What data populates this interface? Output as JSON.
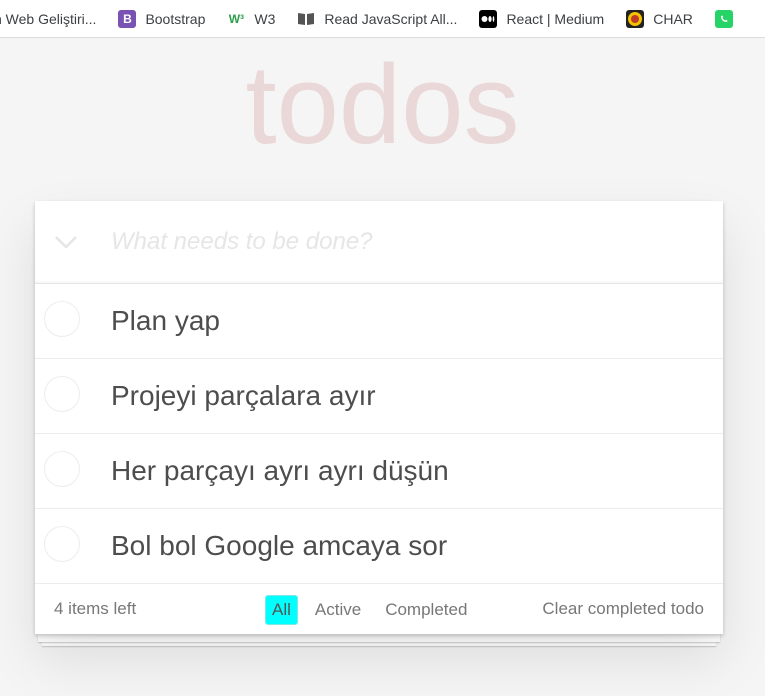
{
  "bookmarks": [
    {
      "label": "n Web Geliştiri...",
      "icon": "none"
    },
    {
      "label": "Bootstrap",
      "icon": "bootstrap-icon",
      "glyph": "B"
    },
    {
      "label": "W3",
      "icon": "w3-icon",
      "glyph": "W³"
    },
    {
      "label": "Read JavaScript All...",
      "icon": "book-icon",
      "glyph": "📖"
    },
    {
      "label": "React | Medium",
      "icon": "medium-icon",
      "glyph": "●●"
    },
    {
      "label": "CHAR",
      "icon": "char-icon",
      "glyph": "☻"
    },
    {
      "label": "",
      "icon": "whatsapp-icon",
      "glyph": "✆"
    }
  ],
  "app": {
    "title": "todos",
    "new_todo_placeholder": "What needs to be done?",
    "toggle_all_icon": "chevron-down-icon"
  },
  "todos": [
    {
      "text": "Plan yap",
      "completed": false
    },
    {
      "text": "Projeyi parçalara ayır",
      "completed": false
    },
    {
      "text": "Her parçayı ayrı ayrı düşün",
      "completed": false
    },
    {
      "text": "Bol bol Google amcaya sor",
      "completed": false
    }
  ],
  "footer": {
    "count_label": "4 items left",
    "filters": [
      "All",
      "Active",
      "Completed"
    ],
    "selected_filter": "All",
    "clear_label": "Clear completed todo"
  },
  "colors": {
    "title": "#af2f2f",
    "selected_filter_bg": "#00ffff",
    "background": "#f5f5f5"
  }
}
